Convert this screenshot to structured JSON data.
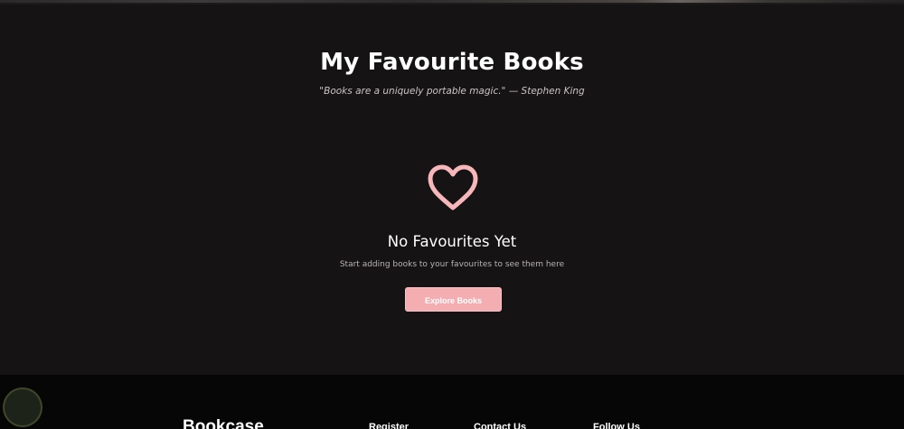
{
  "page": {
    "title": "My Favourite Books",
    "quote": "\"Books are a uniquely portable magic.\" — Stephen King"
  },
  "empty_state": {
    "icon": "heart-outline-icon",
    "title": "No Favourites Yet",
    "subtitle": "Start adding books to your favourites to see them here",
    "button_label": "Explore Books"
  },
  "footer": {
    "brand": "Bookcase",
    "links": {
      "register": "Register",
      "contact": "Contact Us",
      "follow": "Follow Us"
    }
  },
  "colors": {
    "background": "#151314",
    "accent": "#f4adb1",
    "heart": "#f6b6ba",
    "footer_bg": "#070606"
  }
}
